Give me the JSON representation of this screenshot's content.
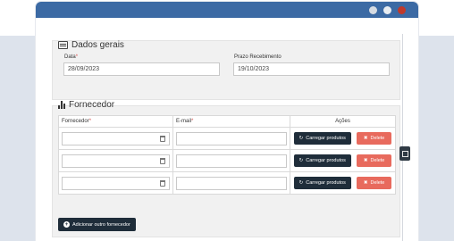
{
  "window": {
    "controls": [
      "minimize",
      "maximize",
      "close"
    ],
    "accent": "#3c6aa4"
  },
  "dados_gerais": {
    "title": "Dados gerais",
    "icon": "list-box-icon",
    "data_label": "Data",
    "data_value": "28/09/2023",
    "prazo_label": "Prazo Recebimento",
    "prazo_value": "19/10/2023"
  },
  "fornecedor": {
    "title": "Fornecedor",
    "icon": "bar-chart-icon",
    "columns": {
      "fornecedor": "Fornecedor",
      "email": "E-mail",
      "acoes": "Ações"
    },
    "required_mark": "*",
    "rows": [
      {
        "fornecedor": "",
        "email": ""
      },
      {
        "fornecedor": "",
        "email": ""
      },
      {
        "fornecedor": "",
        "email": ""
      }
    ],
    "carregar_label": "Carregar produtos",
    "delete_label": "Delete",
    "add_label": "Adicionar outro fornecedor"
  },
  "colors": {
    "dark_button": "#1f2d3a",
    "delete_button": "#e86a5d",
    "required": "#d9534f"
  }
}
